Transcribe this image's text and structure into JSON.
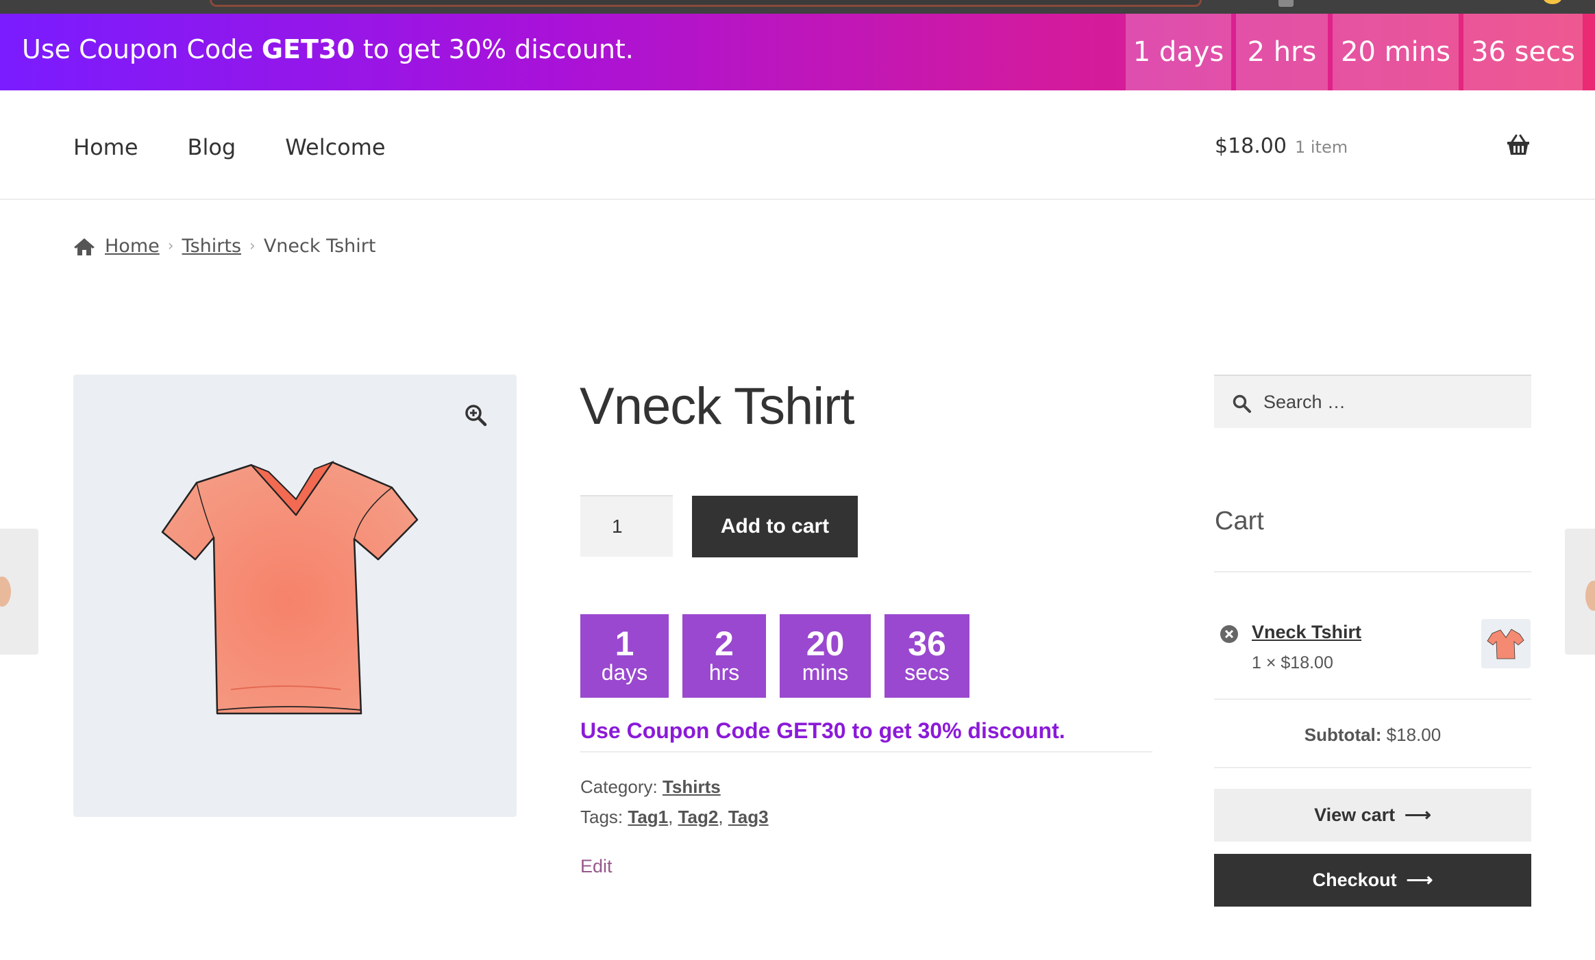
{
  "promo_bar": {
    "text_before": "Use Coupon Code ",
    "code": "GET30",
    "text_after": " to get 30% discount.",
    "timer": [
      "1 days",
      "2 hrs",
      "20 mins",
      "36 secs"
    ]
  },
  "nav": {
    "items": [
      "Home",
      "Blog",
      "Welcome"
    ]
  },
  "header_cart": {
    "amount": "$18.00",
    "count": "1 item",
    "icon": "basket-icon"
  },
  "breadcrumb": {
    "items": [
      "Home",
      "Tshirts",
      "Vneck Tshirt"
    ]
  },
  "product": {
    "title": "Vneck Tshirt",
    "quantity": "1",
    "add_to_cart_label": "Add to cart",
    "timer": [
      {
        "num": "1",
        "unit": "days"
      },
      {
        "num": "2",
        "unit": "hrs"
      },
      {
        "num": "20",
        "unit": "mins"
      },
      {
        "num": "36",
        "unit": "secs"
      }
    ],
    "coupon_message": "Use Coupon Code GET30 to get 30% discount.",
    "category_label": "Category:",
    "category": "Tshirts",
    "tags_label": "Tags:",
    "tags": [
      "Tag1",
      "Tag2",
      "Tag3"
    ],
    "edit_label": "Edit"
  },
  "sidebar": {
    "search_placeholder": "Search …",
    "cart_title": "Cart",
    "cart_item_name": "Vneck Tshirt",
    "cart_item_qty": "1 × $18.00",
    "subtotal_label": "Subtotal:",
    "subtotal_value": " $18.00",
    "view_cart_label": "View cart",
    "checkout_label": "Checkout"
  },
  "colors": {
    "promo_gradient_start": "#7a1cff",
    "promo_gradient_end": "#ea2a72",
    "timer_box": "#9a48cf",
    "coupon_text": "#8b1ad8",
    "button_dark": "#333333",
    "edit_link": "#96588a"
  }
}
